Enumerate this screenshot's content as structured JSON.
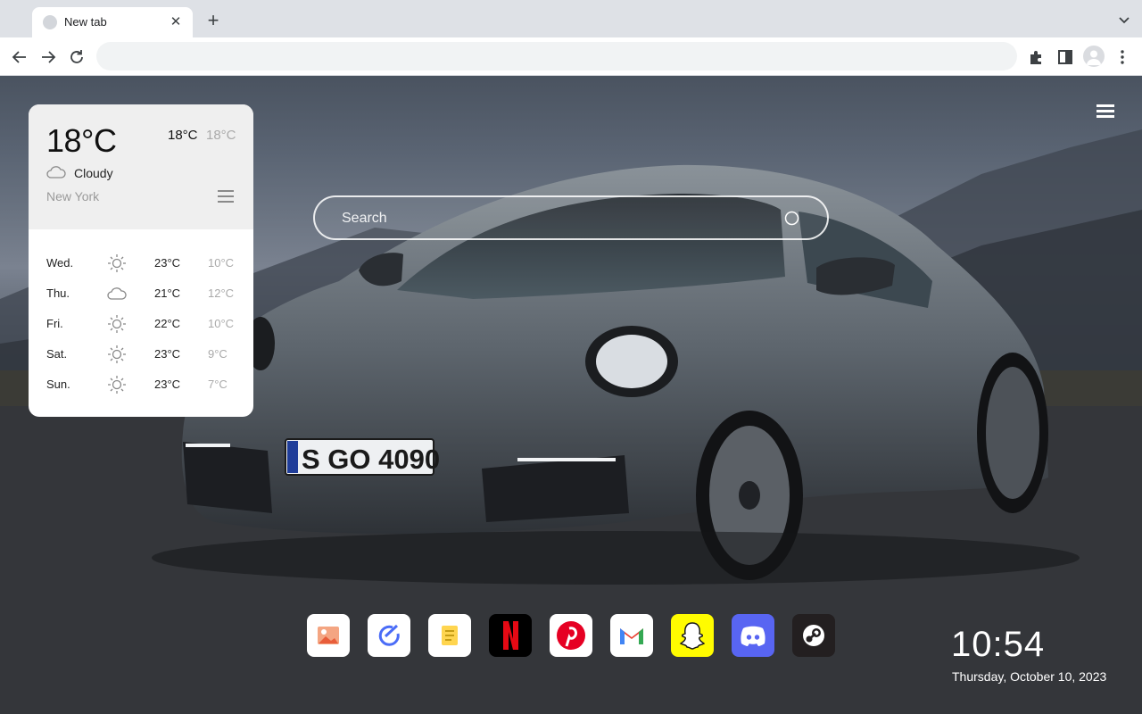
{
  "browser": {
    "tab_title": "New tab",
    "tab_close": "✕",
    "new_tab": "+",
    "address_placeholder": ""
  },
  "weather": {
    "current_temp": "18°C",
    "high": "18°C",
    "low": "18°C",
    "condition": "Cloudy",
    "city": "New York",
    "forecast": [
      {
        "day": "Wed.",
        "icon": "sun-icon",
        "high": "23°C",
        "low": "10°C"
      },
      {
        "day": "Thu.",
        "icon": "cloud-icon",
        "high": "21°C",
        "low": "12°C"
      },
      {
        "day": "Fri.",
        "icon": "sun-icon",
        "high": "22°C",
        "low": "10°C"
      },
      {
        "day": "Sat.",
        "icon": "sun-icon",
        "high": "23°C",
        "low": "9°C"
      },
      {
        "day": "Sun.",
        "icon": "sun-icon",
        "high": "23°C",
        "low": "7°C"
      }
    ]
  },
  "search": {
    "placeholder": "Search"
  },
  "dock": [
    {
      "name": "photos-app-icon"
    },
    {
      "name": "tasks-app-icon"
    },
    {
      "name": "notes-app-icon"
    },
    {
      "name": "netflix-app-icon"
    },
    {
      "name": "pinterest-app-icon"
    },
    {
      "name": "gmail-app-icon"
    },
    {
      "name": "snapchat-app-icon"
    },
    {
      "name": "discord-app-icon"
    },
    {
      "name": "steam-app-icon"
    }
  ],
  "clock": {
    "time": "10:54",
    "date": "Thursday, October 10, 2023"
  },
  "colors": {
    "netflix": "#000000",
    "pinterest": "#e60023",
    "snapchat": "#fffc00",
    "discord": "#5865f2",
    "steam": "#231f20"
  }
}
